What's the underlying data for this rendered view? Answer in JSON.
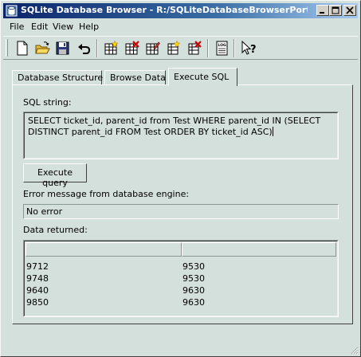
{
  "window": {
    "title": "SQLite Database Browser - R:/SQLiteDatabaseBrowserPortabl...",
    "title_gradient_start": "#0a246a",
    "title_gradient_end": "#a6caf0",
    "face_color": "#d4e0dc"
  },
  "menubar": {
    "items": [
      {
        "label": "File"
      },
      {
        "label": "Edit"
      },
      {
        "label": "View"
      },
      {
        "label": "Help"
      }
    ]
  },
  "toolbar": {
    "buttons": [
      {
        "icon": "new-file-icon"
      },
      {
        "icon": "open-folder-icon"
      },
      {
        "icon": "save-disk-icon"
      },
      {
        "icon": "undo-icon"
      },
      {
        "icon": "create-table-icon"
      },
      {
        "icon": "delete-table-icon"
      },
      {
        "icon": "modify-table-icon"
      },
      {
        "icon": "create-index-icon"
      },
      {
        "icon": "delete-index-icon"
      },
      {
        "icon": "log-icon"
      },
      {
        "icon": "whats-this-icon"
      }
    ]
  },
  "tabs": [
    {
      "label": "Database Structure",
      "active": false
    },
    {
      "label": "Browse Data",
      "active": false
    },
    {
      "label": "Execute SQL",
      "active": true
    }
  ],
  "execute_sql": {
    "sql_label": "SQL string:",
    "sql_line1": "SELECT ticket_id, parent_id from Test WHERE parent_id IN (SELECT",
    "sql_line2": "DISTINCT parent_id FROM Test ORDER BY ticket_id ASC)",
    "execute_button": "Execute query",
    "error_label": "Error message from database engine:",
    "error_value": "No error",
    "data_label": "Data returned:",
    "columns": [
      "",
      ""
    ],
    "rows": [
      [
        "9712",
        "9530"
      ],
      [
        "9748",
        "9530"
      ],
      [
        "9640",
        "9630"
      ],
      [
        "9850",
        "9630"
      ]
    ]
  }
}
